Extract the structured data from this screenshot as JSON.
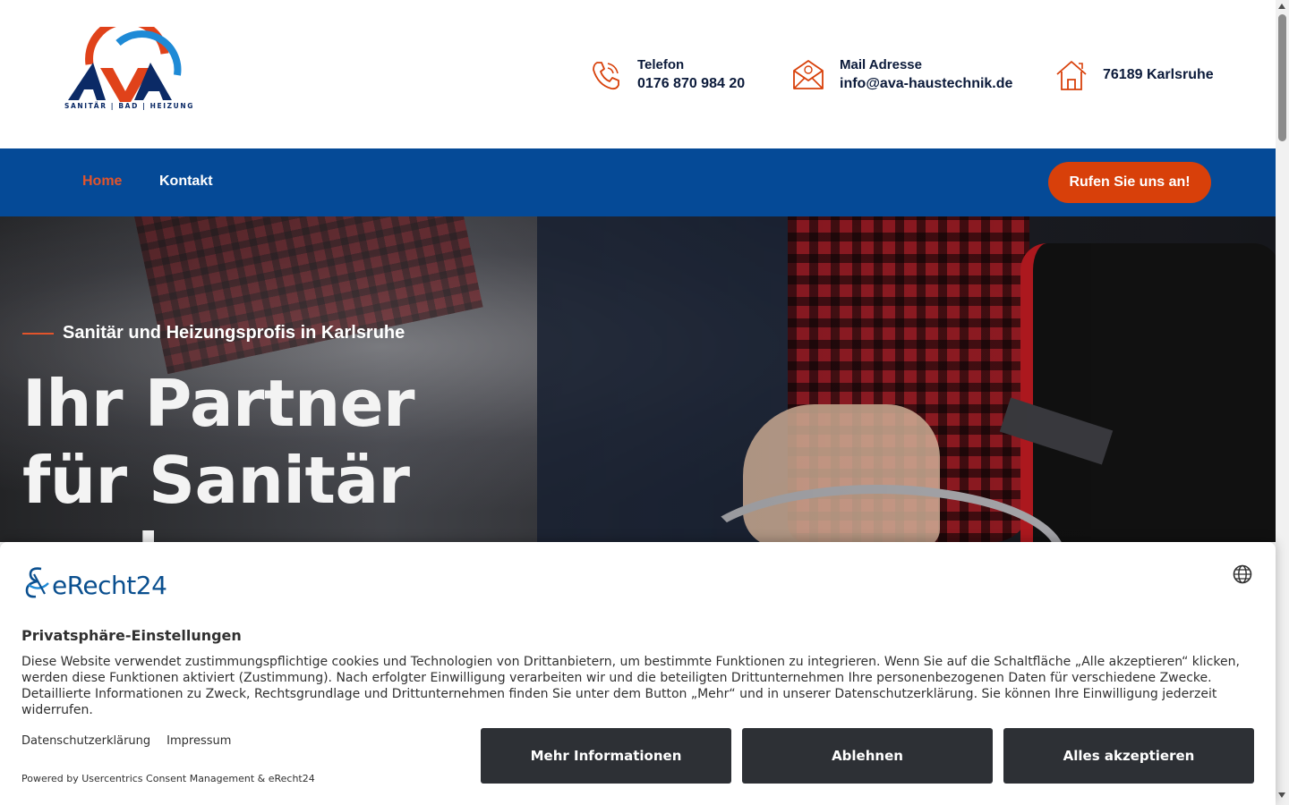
{
  "header": {
    "logo_text": "AVA",
    "logo_tagline": "SANITÄR | BAD | HEIZUNG",
    "contacts": [
      {
        "icon": "phone-icon",
        "label": "Telefon",
        "value": "0176 870 984 20"
      },
      {
        "icon": "mail-icon",
        "label": "Mail Adresse",
        "value": "info@ava-haustechnik.de"
      },
      {
        "icon": "home-icon",
        "label": "",
        "value": "76189 Karlsruhe"
      }
    ]
  },
  "nav": {
    "items": [
      {
        "label": "Home",
        "active": true
      },
      {
        "label": "Kontakt",
        "active": false
      }
    ],
    "cta_label": "Rufen Sie uns an!"
  },
  "hero": {
    "kicker": "Sanitär und Heizungsprofis in Karlsruhe",
    "title": "Ihr Partner für Sanitär und Badumbau"
  },
  "consent": {
    "brand": "eRecht24",
    "language_icon": "globe-icon",
    "title": "Privatsphäre-Einstellungen",
    "text": "Diese Website verwendet zustimmungspflichtige cookies und Technologien von Drittanbietern, um bestimmte Funktionen zu integrieren. Wenn Sie auf die Schaltfläche „Alle akzeptieren“ klicken, werden diese Funktionen aktiviert (Zustimmung). Nach erfolgter Einwilligung verarbeiten wir und die beteiligten Drittunternehmen Ihre personenbezogenen Daten für verschiedene Zwecke. Detaillierte Informationen zu Zweck, Rechtsgrundlage und Drittunternehmen finden Sie unter dem Button „Mehr“ und in unserer Datenschutzerklärung. Sie können Ihre Einwilligung jederzeit widerrufen.",
    "links": [
      "Datenschutzerklärung",
      "Impressum"
    ],
    "powered_by": "Powered by Usercentrics Consent Management & eRecht24",
    "buttons": {
      "more": "Mehr Informationen",
      "deny": "Ablehnen",
      "accept": "Alles akzeptieren"
    }
  },
  "colors": {
    "nav_blue": "#054a97",
    "accent_orange": "#d8400a",
    "consent_button": "#2d3035"
  }
}
